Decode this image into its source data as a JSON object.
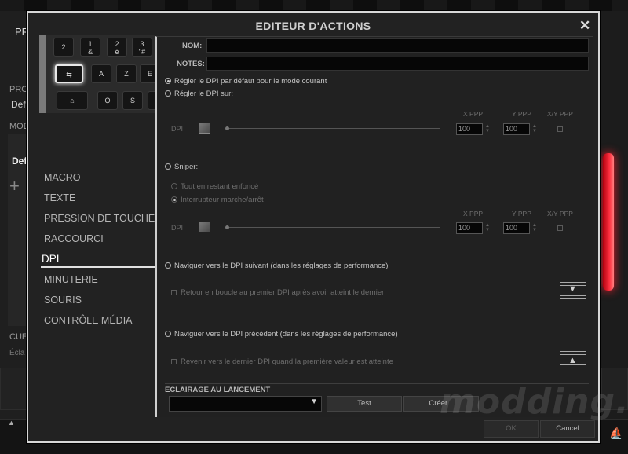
{
  "background_app": {
    "tab_fragment": "PR",
    "left_labels": [
      "PRO",
      "Def",
      "MOD",
      "Def",
      "CUE",
      "Écla"
    ],
    "add_icon": "plus-icon",
    "scroll_up_icon": "triangle-up-icon",
    "brand_icon": "corsair-sails-icon"
  },
  "dialog": {
    "title": "EDITEUR D'ACTIONS",
    "close_icon": "close-icon"
  },
  "keyboard": {
    "keys_row1": [
      "2",
      "1\n&",
      "2\né",
      "3\n\"#"
    ],
    "keys_row2": [
      "⇆",
      "A",
      "Z",
      "E"
    ],
    "keys_row3": [
      "⌂",
      "Q",
      "S",
      ""
    ]
  },
  "menu": {
    "items": [
      {
        "label": "MACRO"
      },
      {
        "label": "TEXTE"
      },
      {
        "label": "PRESSION DE TOUCHE"
      },
      {
        "label": "RACCOURCI"
      },
      {
        "label": "DPI",
        "active": true
      },
      {
        "label": "MINUTERIE"
      },
      {
        "label": "SOURIS"
      },
      {
        "label": "CONTRÔLE MÉDIA"
      }
    ]
  },
  "form": {
    "name_label": "NOM:",
    "name_value": "",
    "notes_label": "NOTES:",
    "notes_value": "",
    "opt_default": "Régler le DPI par défaut pour le mode courant",
    "opt_set": "Régler le DPI sur:",
    "col_x": "X PPP",
    "col_y": "Y PPP",
    "col_xy": "X/Y PPP",
    "dpi_label": "DPI",
    "x_value_1": "100",
    "y_value_1": "100",
    "opt_sniper": "Sniper:",
    "sniper_hold": "Tout en restant enfoncé",
    "sniper_toggle": "Interrupteur marche/arrêt",
    "x_value_2": "100",
    "y_value_2": "100",
    "opt_next": "Naviguer vers le DPI suivant (dans les réglages de performance)",
    "loop_next": "Retour en boucle au premier DPI après avoir atteint le dernier",
    "opt_prev": "Naviguer vers le DPI précédent (dans les réglages de performance)",
    "loop_prev": "Revenir vers le dernier DPI quand la première valeur est atteinte",
    "move_down_icon": "arrow-down-bar-icon",
    "move_up_icon": "arrow-up-bar-icon",
    "lighting_label": "ECLAIRAGE AU LANCEMENT",
    "lighting_value": "",
    "test_label": "Test",
    "create_label": "Créer..."
  },
  "buttons": {
    "ok": "OK",
    "cancel": "Cancel"
  },
  "watermark": "modding.fr"
}
